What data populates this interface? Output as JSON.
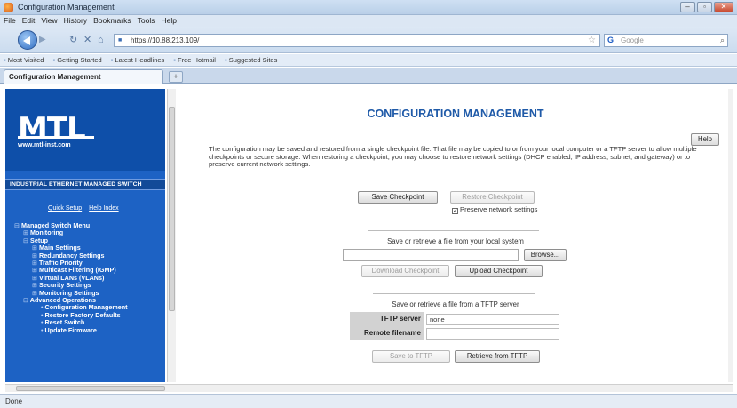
{
  "window": {
    "title": "Configuration Management",
    "buttons": [
      "–",
      "▫",
      "✕"
    ]
  },
  "menu": [
    "File",
    "Edit",
    "View",
    "History",
    "Bookmarks",
    "Tools",
    "Help"
  ],
  "navbar": {
    "url": "https://10.88.213.109/",
    "search_placeholder": "Google"
  },
  "bookmarks": [
    "Most Visited",
    "Getting Started",
    "Latest Headlines",
    "Free Hotmail",
    "Suggested Sites"
  ],
  "tab": {
    "label": "Configuration Management",
    "new_tab": "+"
  },
  "sidebar": {
    "logo": "MTL",
    "logo_url": "www.mtl-inst.com",
    "brand": "INDUSTRIAL ETHERNET MANAGED SWITCH",
    "quick_links": [
      "Quick Setup",
      "Help Index"
    ],
    "tree": [
      {
        "prefix": "⊟",
        "label": "Managed Switch Menu",
        "level": 1
      },
      {
        "prefix": "⊞",
        "label": "Monitoring",
        "level": 2
      },
      {
        "prefix": "⊟",
        "label": "Setup",
        "level": 2
      },
      {
        "prefix": "⊞",
        "label": "Main Settings",
        "level": 3
      },
      {
        "prefix": "⊞",
        "label": "Redundancy Settings",
        "level": 3
      },
      {
        "prefix": "⊞",
        "label": "Traffic Priority",
        "level": 3
      },
      {
        "prefix": "⊞",
        "label": "Multicast Filtering (IGMP)",
        "level": 3
      },
      {
        "prefix": "⊞",
        "label": "Virtual LANs (VLANs)",
        "level": 3
      },
      {
        "prefix": "⊞",
        "label": "Security Settings",
        "level": 3
      },
      {
        "prefix": "⊞",
        "label": "Monitoring Settings",
        "level": 3
      },
      {
        "prefix": "⊟",
        "label": "Advanced Operations",
        "level": 2
      },
      {
        "prefix": "•",
        "label": "Configuration Management",
        "level": 4
      },
      {
        "prefix": "•",
        "label": "Restore Factory Defaults",
        "level": 4
      },
      {
        "prefix": "•",
        "label": "Reset Switch",
        "level": 4
      },
      {
        "prefix": "•",
        "label": "Update Firmware",
        "level": 4
      }
    ]
  },
  "content": {
    "title": "CONFIGURATION MANAGEMENT",
    "help_label": "Help",
    "description": "The configuration may be saved and restored from a single checkpoint file. That file may be copied to or from your local computer or a TFTP server to allow multiple checkpoints or secure storage. When restoring a checkpoint, you may choose to restore network settings (DHCP enabled, IP address, subnet, and gateway) or to preserve current network settings.",
    "save_checkpoint": "Save Checkpoint",
    "restore_checkpoint": "Restore Checkpoint",
    "preserve_label": "Preserve network settings",
    "preserve_checked": true,
    "local_heading": "Save or retrieve a file from your local system",
    "browse": "Browse...",
    "download_checkpoint": "Download Checkpoint",
    "upload_checkpoint": "Upload Checkpoint",
    "tftp_heading": "Save or retrieve a file from a TFTP server",
    "tftp_server_label": "TFTP server",
    "tftp_server_value": "none",
    "remote_filename_label": "Remote filename",
    "remote_filename_value": "",
    "save_to_tftp": "Save to TFTP",
    "retrieve_from_tftp": "Retrieve from TFTP"
  },
  "status": "Done"
}
